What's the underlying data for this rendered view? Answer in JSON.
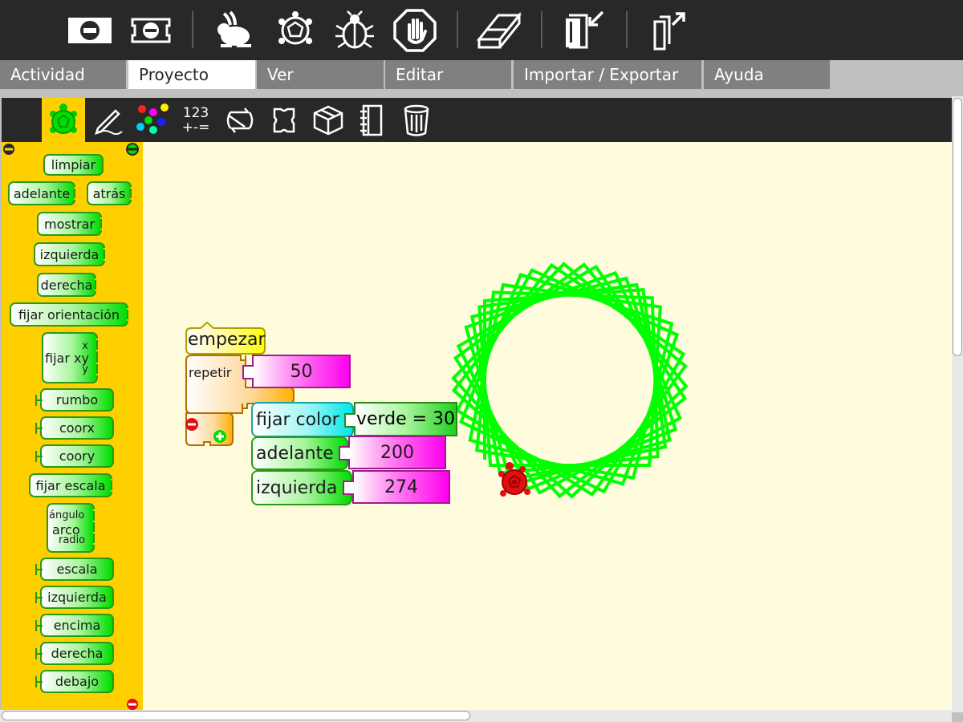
{
  "toolbar": {
    "icons": [
      "stop-icon",
      "stop-turtle-icon",
      "rabbit-icon",
      "turtle-slow-icon",
      "bug-icon",
      "stop-hand-icon",
      "eraser-icon",
      "import-icon",
      "export-icon"
    ]
  },
  "menu": {
    "tabs": [
      {
        "label": "Actividad",
        "active": false
      },
      {
        "label": "Proyecto",
        "active": true
      },
      {
        "label": "Ver",
        "active": false
      },
      {
        "label": "Editar",
        "active": false
      },
      {
        "label": "Importar / Exportar",
        "active": false
      },
      {
        "label": "Ayuda",
        "active": false
      }
    ]
  },
  "palette_toolbar": {
    "numbers_line1": "123",
    "numbers_line2": "+-=",
    "selected": "turtle"
  },
  "palette": {
    "blocks": {
      "clear": "limpiar",
      "forward": "adelante",
      "back": "atrás",
      "show": "mostrar",
      "left": "izquierda",
      "right": "derecha",
      "seth": "fijar orientación",
      "setxy": "fijar xy",
      "setxy_x": "x",
      "setxy_y": "y",
      "heading": "rumbo",
      "xcor": "coorx",
      "ycor": "coory",
      "setscale": "fijar escala",
      "arc": "arco",
      "arc_angle": "ángulo",
      "arc_radius": "radio",
      "scale": "escala",
      "leftpos": "izquierda",
      "toppos": "encima",
      "rightpos": "derecha",
      "bottompos": "debajo"
    }
  },
  "script": {
    "start": "empezar",
    "repeat": "repetir",
    "repeat_count": "50",
    "setcolor": "fijar color",
    "color_value": "verde = 30",
    "forward": "adelante",
    "forward_value": "200",
    "left": "izquierda",
    "left_value": "274"
  },
  "colors": {
    "turtle_pen": "#00ff00",
    "turtle": "#e01010",
    "canvas": "#fffcde",
    "palette": "#ffd000"
  }
}
